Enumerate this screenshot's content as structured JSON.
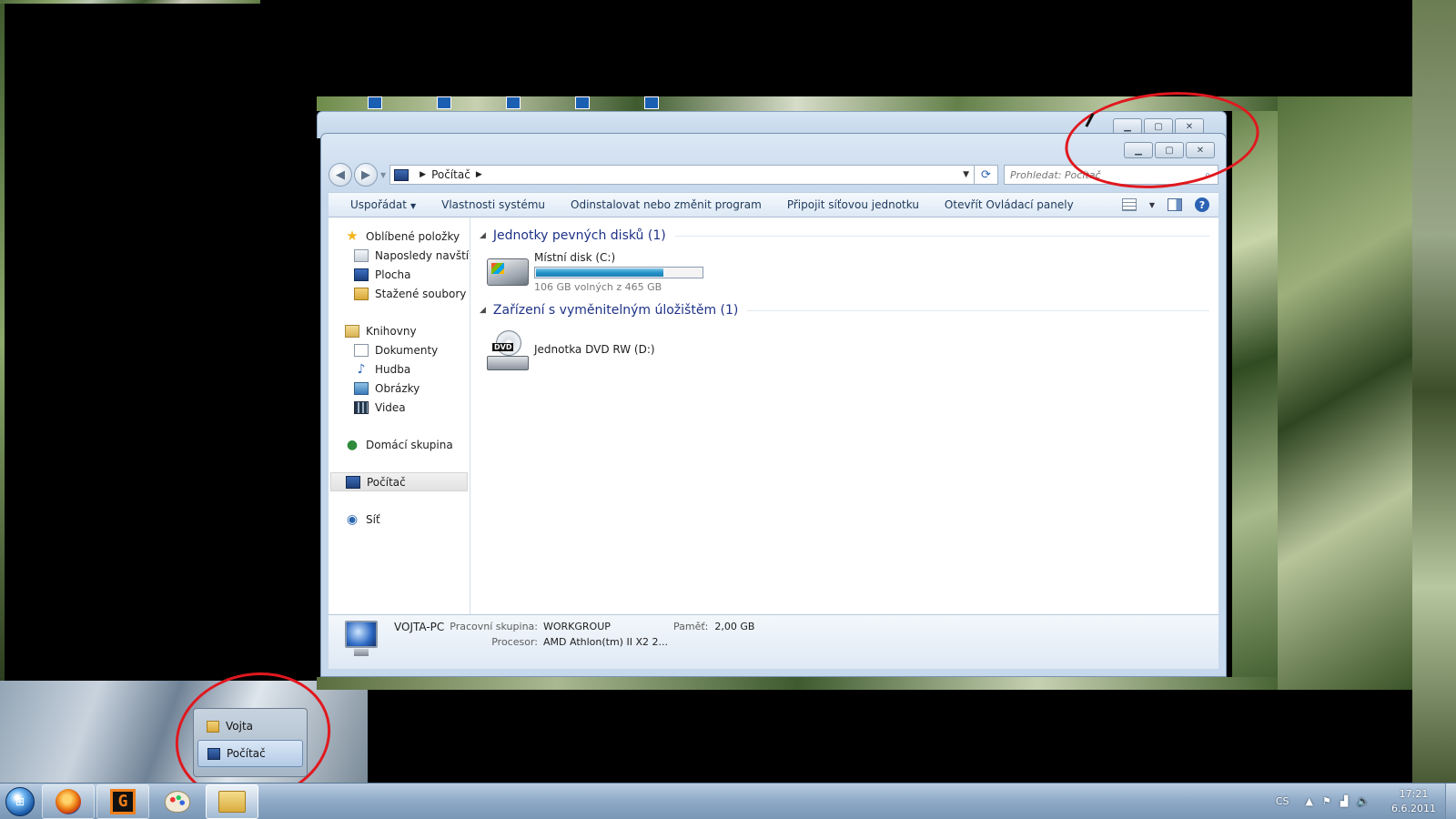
{
  "explorer": {
    "address": {
      "location": "Počítač",
      "search_placeholder": "Prohledat: Počítač"
    },
    "toolbar": {
      "organize": "Uspořádat",
      "system_properties": "Vlastnosti systému",
      "uninstall": "Odinstalovat nebo změnit program",
      "map_drive": "Připojit síťovou jednotku",
      "control_panel": "Otevřít Ovládací panely"
    },
    "nav": {
      "favorites": "Oblíbené položky",
      "recent": "Naposledy navštívené",
      "desktop": "Plocha",
      "downloads": "Stažené soubory",
      "libraries": "Knihovny",
      "documents": "Dokumenty",
      "music": "Hudba",
      "pictures": "Obrázky",
      "videos": "Videa",
      "homegroup": "Domácí skupina",
      "computer": "Počítač",
      "network": "Síť"
    },
    "groups": {
      "hard_disks": "Jednotky pevných disků (1)",
      "removable": "Zařízení s vyměnitelným úložištěm (1)"
    },
    "drives": {
      "c_name": "Místní disk (C:)",
      "c_free": "106 GB volných z 465 GB",
      "c_used_fraction": 0.77,
      "d_name": "Jednotka DVD RW (D:)",
      "d_label": "DVD"
    },
    "details": {
      "pc_name": "VOJTA-PC",
      "workgroup_label": "Pracovní skupina:",
      "workgroup_value": "WORKGROUP",
      "memory_label": "Paměť:",
      "memory_value": "2,00 GB",
      "cpu_label": "Procesor:",
      "cpu_value": "AMD Athlon(tm) II X2 2..."
    }
  },
  "jumplist": {
    "item1": "Vojta",
    "item2": "Počítač"
  },
  "taskbar": {
    "language": "CS",
    "time": "17:21",
    "date": "6.6.2011"
  }
}
